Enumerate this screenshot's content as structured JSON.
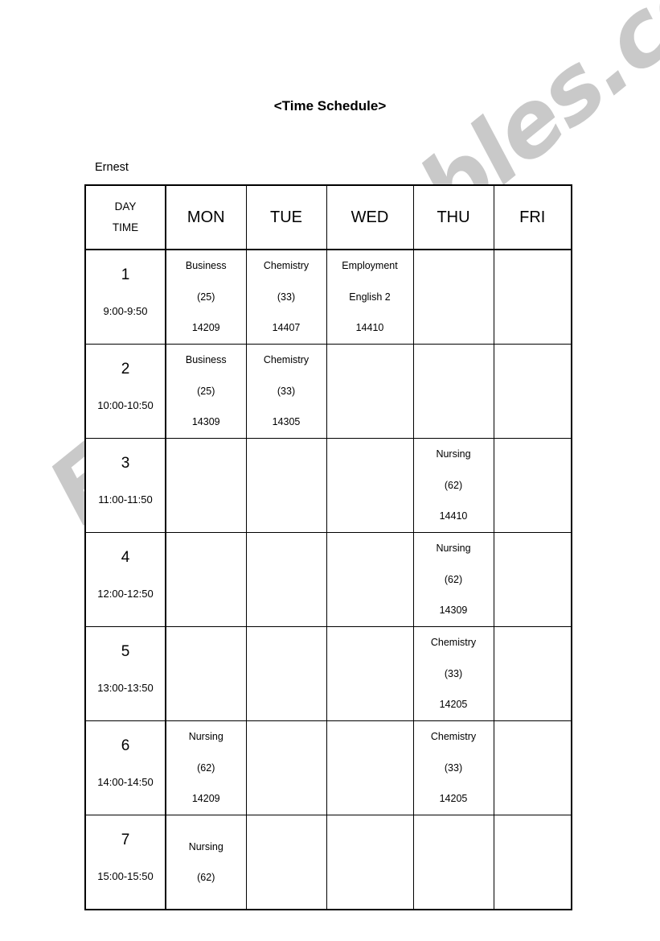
{
  "document": {
    "title": "<Time Schedule>",
    "student_name": "Ernest",
    "watermark": "ESLprintables.com"
  },
  "table": {
    "corner": {
      "day_label": "DAY",
      "time_label": "TIME"
    },
    "day_headers": [
      "MON",
      "TUE",
      "WED",
      "THU",
      "FRI"
    ],
    "rows": [
      {
        "period": "1",
        "time": "9:00-9:50",
        "cells": [
          {
            "lines": [
              "Business",
              "(25)",
              "14209"
            ]
          },
          {
            "lines": [
              "Chemistry",
              "(33)",
              "14407"
            ]
          },
          {
            "lines": [
              "Employment",
              "English 2",
              "14410"
            ]
          },
          {
            "lines": []
          },
          {
            "lines": []
          }
        ]
      },
      {
        "period": "2",
        "time": "10:00-10:50",
        "cells": [
          {
            "lines": [
              "Business",
              "(25)",
              "14309"
            ]
          },
          {
            "lines": [
              "Chemistry",
              "(33)",
              "14305"
            ]
          },
          {
            "lines": []
          },
          {
            "lines": []
          },
          {
            "lines": []
          }
        ]
      },
      {
        "period": "3",
        "time": "11:00-11:50",
        "cells": [
          {
            "lines": []
          },
          {
            "lines": []
          },
          {
            "lines": []
          },
          {
            "lines": [
              "Nursing",
              "(62)",
              "14410"
            ]
          },
          {
            "lines": []
          }
        ]
      },
      {
        "period": "4",
        "time": "12:00-12:50",
        "cells": [
          {
            "lines": []
          },
          {
            "lines": []
          },
          {
            "lines": []
          },
          {
            "lines": [
              "Nursing",
              "(62)",
              "14309"
            ]
          },
          {
            "lines": []
          }
        ]
      },
      {
        "period": "5",
        "time": "13:00-13:50",
        "cells": [
          {
            "lines": []
          },
          {
            "lines": []
          },
          {
            "lines": []
          },
          {
            "lines": [
              "Chemistry",
              "(33)",
              "14205"
            ]
          },
          {
            "lines": []
          }
        ]
      },
      {
        "period": "6",
        "time": "14:00-14:50",
        "cells": [
          {
            "lines": [
              "Nursing",
              "(62)",
              "14209"
            ]
          },
          {
            "lines": []
          },
          {
            "lines": []
          },
          {
            "lines": [
              "Chemistry",
              "(33)",
              "14205"
            ]
          },
          {
            "lines": []
          }
        ]
      },
      {
        "period": "7",
        "time": "15:00-15:50",
        "cells": [
          {
            "lines": [
              "Nursing",
              "(62)"
            ]
          },
          {
            "lines": []
          },
          {
            "lines": []
          },
          {
            "lines": []
          },
          {
            "lines": []
          }
        ]
      }
    ]
  }
}
